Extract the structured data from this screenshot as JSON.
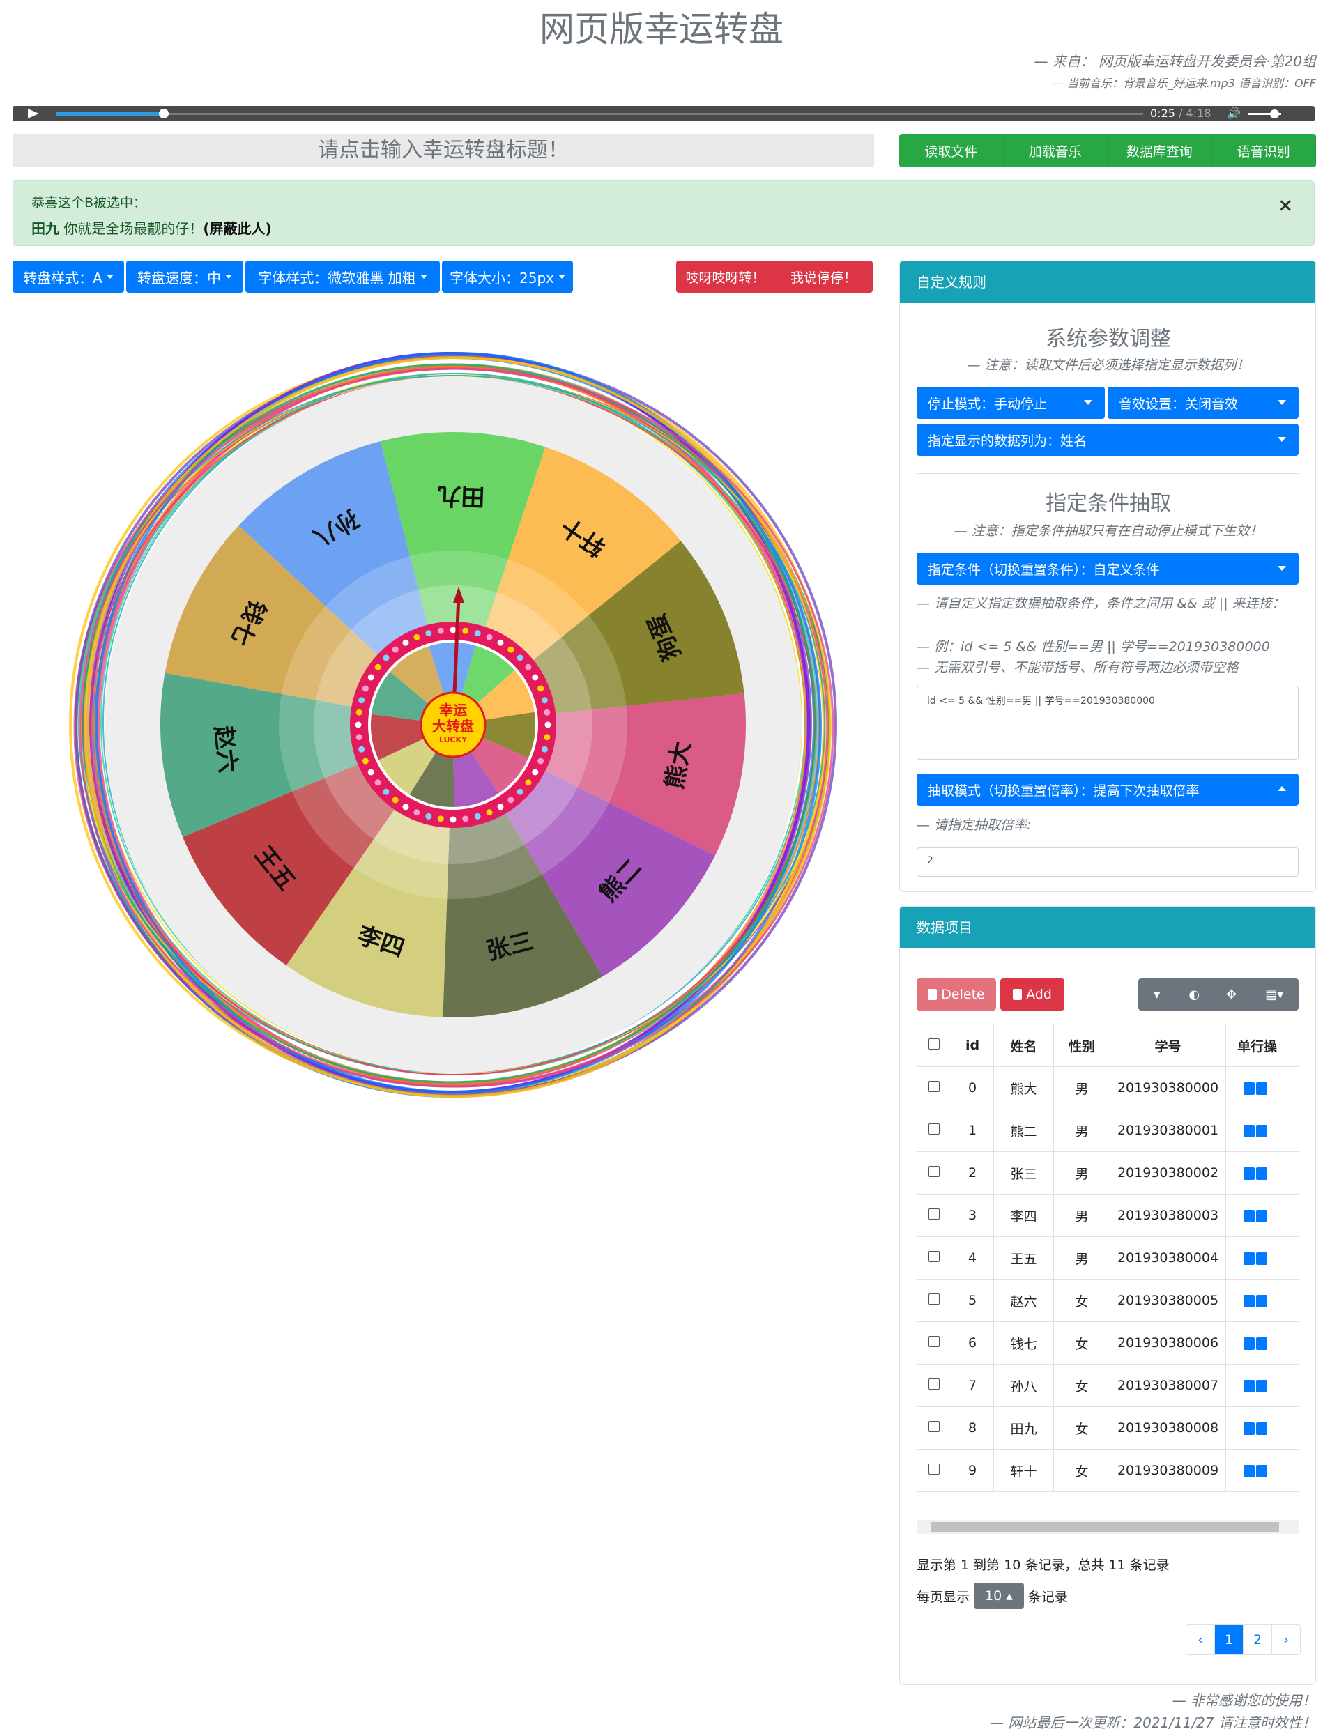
{
  "header": {
    "title": "网页版幸运转盘",
    "credit_from": "— 来自：  网页版幸运转盘开发委员会·第20组",
    "credit_music": "— 当前音乐：背景音乐_好运来.mp3 语音识别：OFF"
  },
  "audio": {
    "current": "0:25",
    "duration": "/ 4:18",
    "progress": 0.1,
    "volume": 0.7
  },
  "wheel_title_placeholder": "请点击输入幸运转盘标题！",
  "top_buttons": [
    "读取文件",
    "加载音乐",
    "数据库查询",
    "语音识别"
  ],
  "alert": {
    "line1": "恭喜这个B被选中：",
    "winner": "田九",
    "message": " 你就是全场最靓的仔！",
    "block": "(屏蔽此人)",
    "close": "×"
  },
  "toolbar": {
    "style": "转盘样式：A",
    "speed": "转盘速度：中",
    "font": "字体样式：微软雅黑 加粗",
    "size": "字体大小：25px"
  },
  "actions": {
    "spin": "吱呀吱呀转！",
    "stop": "我说停停！"
  },
  "wheel": {
    "segments": [
      {
        "name": "田九",
        "color": "#56d152"
      },
      {
        "name": "轩十",
        "color": "#ffb53d"
      },
      {
        "name": "狗蛋",
        "color": "#787312"
      },
      {
        "name": "熊大",
        "color": "#d8477a"
      },
      {
        "name": "熊二",
        "color": "#9b3fb6"
      },
      {
        "name": "张三",
        "color": "#566238"
      },
      {
        "name": "李四",
        "color": "#cfcb6e"
      },
      {
        "name": "王五",
        "color": "#b7282c"
      },
      {
        "name": "赵六",
        "color": "#3e9f7a"
      },
      {
        "name": "钱七",
        "color": "#cfa13f"
      },
      {
        "name": "孙八",
        "color": "#5b97f2"
      }
    ],
    "hub_text": [
      "幸运",
      "大转盘",
      "LUCKY"
    ]
  },
  "rules": {
    "header": "自定义规则",
    "sys_title": "系统参数调整",
    "sys_note": "— 注意：读取文件后必须选择指定显示数据列！",
    "stop_mode": "停止模式：手动停止",
    "sound": "音效设置：关闭音效",
    "display_col": "指定显示的数据列为：姓名",
    "cond_title": "指定条件抽取",
    "cond_note": "— 注意：指定条件抽取只有在自动停止模式下生效！",
    "cond_btn": "指定条件（切换重置条件）：自定义条件",
    "hint1": "— 请自定义指定数据抽取条件，条件之间用 && 或 || 来连接：",
    "hint2": "— 例：id <= 5 && 性别==男 || 学号==201930380000",
    "hint3": "— 无需双引号、不能带括号、所有符号两边必须带空格",
    "cond_value": "id <= 5 && 性别==男 || 学号==201930380000",
    "draw_btn": "抽取模式（切换重置倍率）：提高下次抽取倍率",
    "rate_note": "— 请指定抽取倍率:",
    "rate_value": "2"
  },
  "data_panel": {
    "header": "数据项目",
    "delete": "Delete",
    "add": "Add",
    "columns": [
      "id",
      "姓名",
      "性别",
      "学号",
      "单行操"
    ],
    "rows": [
      [
        "0",
        "熊大",
        "男",
        "201930380000"
      ],
      [
        "1",
        "熊二",
        "男",
        "201930380001"
      ],
      [
        "2",
        "张三",
        "男",
        "201930380002"
      ],
      [
        "3",
        "李四",
        "男",
        "201930380003"
      ],
      [
        "4",
        "王五",
        "男",
        "201930380004"
      ],
      [
        "5",
        "赵六",
        "女",
        "201930380005"
      ],
      [
        "6",
        "钱七",
        "女",
        "201930380006"
      ],
      [
        "7",
        "孙八",
        "女",
        "201930380007"
      ],
      [
        "8",
        "田九",
        "女",
        "201930380008"
      ],
      [
        "9",
        "轩十",
        "女",
        "201930380009"
      ]
    ],
    "summary": "显示第 1 到第 10 条记录，总共 11 条记录",
    "per_page_pre": "每页显示",
    "per_page": "10",
    "per_page_post": "条记录",
    "pages": [
      "‹",
      "1",
      "2",
      "›"
    ]
  },
  "footer": {
    "thanks": "— 非常感谢您的使用！",
    "updated": "— 网站最后一次更新：2021/11/27 请注意时效性！"
  }
}
